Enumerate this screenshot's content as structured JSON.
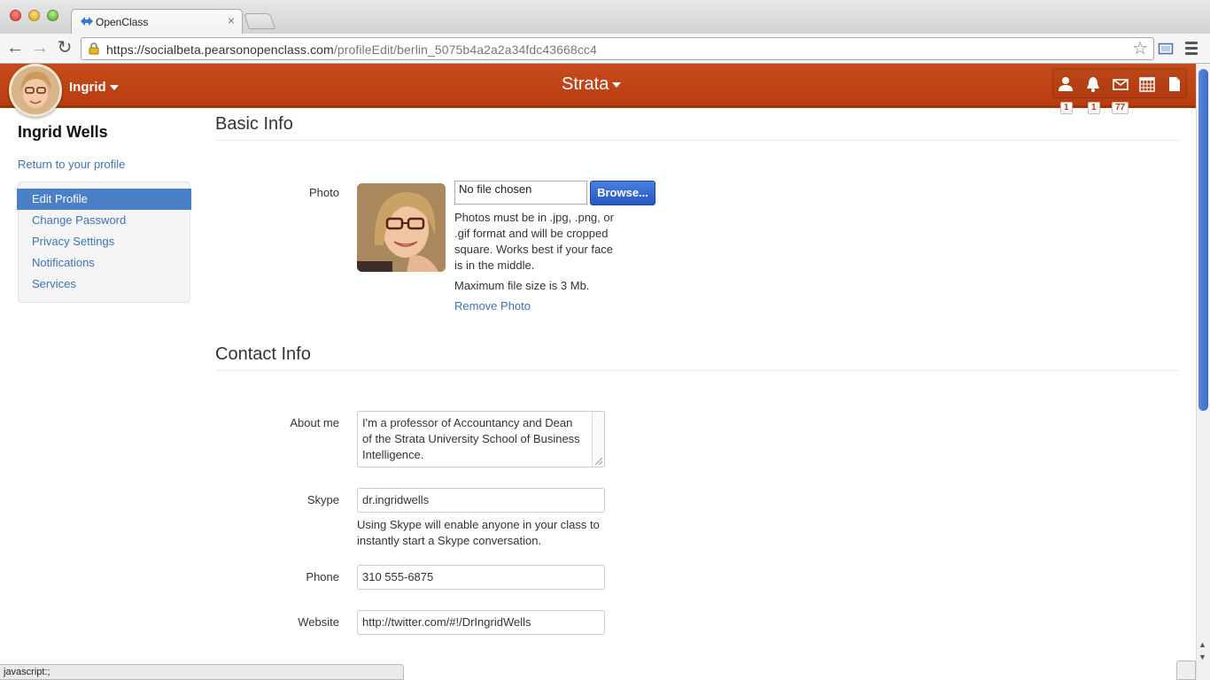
{
  "browser": {
    "tab_title": "OpenClass",
    "tab_close": "×",
    "url_host": "https://socialbeta.pearsonopenclass.com",
    "url_path": "/profileEdit/berlin_5075b4a2a2a34fdc43668cc4",
    "status_text": "javascript:;"
  },
  "header": {
    "user_name": "Ingrid",
    "course_name": "Strata",
    "badges": {
      "people": "1",
      "notifications": "1",
      "messages": "77"
    },
    "colors": {
      "bar": "#c04618",
      "badge_text": "#b83c10"
    }
  },
  "sidebar": {
    "profile_name": "Ingrid Wells",
    "return_link": "Return to your profile",
    "items": [
      {
        "label": "Edit Profile",
        "active": true
      },
      {
        "label": "Change Password",
        "active": false
      },
      {
        "label": "Privacy Settings",
        "active": false
      },
      {
        "label": "Notifications",
        "active": false
      },
      {
        "label": "Services",
        "active": false
      }
    ]
  },
  "basic_info": {
    "title": "Basic Info",
    "photo_label": "Photo",
    "file_status": "No file chosen",
    "browse_label": "Browse...",
    "help_lines": [
      "Photos must be in .jpg, .png, or",
      ".gif format and will be cropped",
      "square. Works best if your face",
      "is in the middle."
    ],
    "max_size": "Maximum file size is 3 Mb.",
    "remove_photo": "Remove Photo"
  },
  "contact_info": {
    "title": "Contact Info",
    "about_label": "About me",
    "about_lines": [
      "I'm a professor of Accountancy and Dean",
      "of the Strata University School of Business",
      "Intelligence."
    ],
    "skype_label": "Skype",
    "skype_value": "dr.ingridwells",
    "skype_help_lines": [
      "Using Skype will enable anyone in your class to",
      "instantly start a Skype conversation."
    ],
    "phone_label": "Phone",
    "phone_value": "310 555-6875",
    "website_label": "Website",
    "website_value": "http://twitter.com/#!/DrIngridWells"
  }
}
